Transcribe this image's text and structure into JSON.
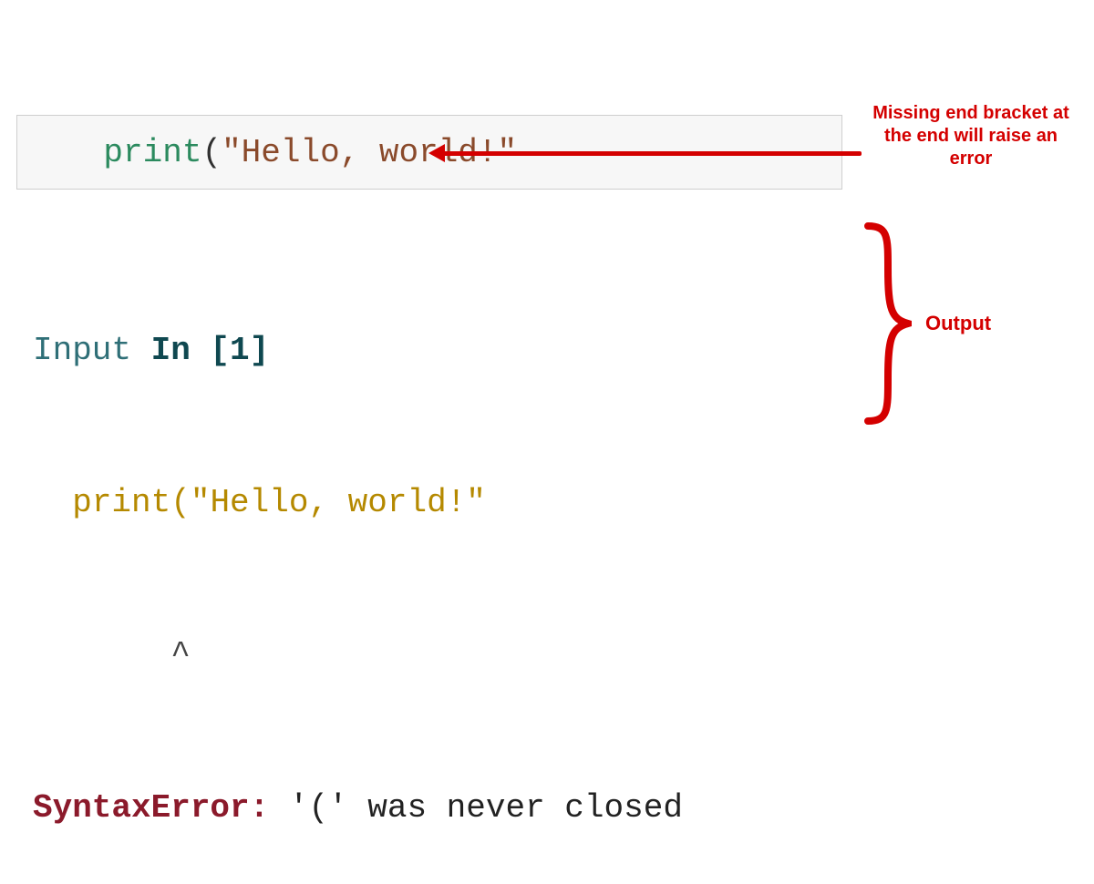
{
  "code": {
    "func": "print",
    "open_paren": "(",
    "string": "\"Hello, world!\""
  },
  "annotations": {
    "missing_bracket": "Missing end bracket at the end will raise an error",
    "output_label": "Output"
  },
  "output": {
    "input_label_1": "Input ",
    "input_label_2": "In [1]",
    "echo_indent": "  ",
    "echo_line": "print(\"Hello, world!\"",
    "caret_indent": "       ",
    "caret": "^",
    "error_name": "SyntaxError:",
    "error_msg": " '(' was never closed"
  }
}
